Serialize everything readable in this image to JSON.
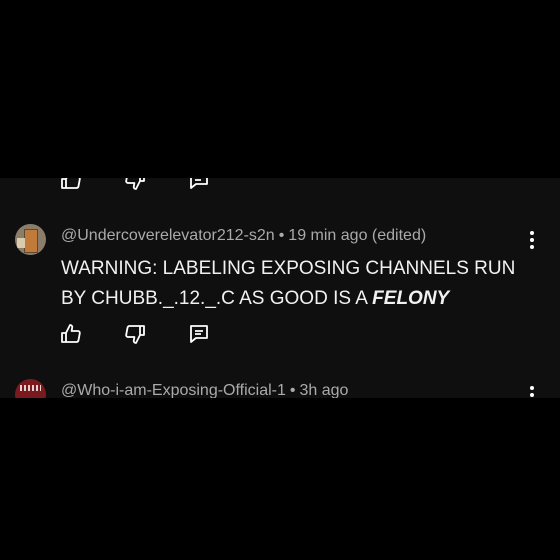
{
  "comments": [
    {
      "author": "@Undercoverelevator212-s2n",
      "time": "19 min ago",
      "edited": "(edited)",
      "text": "WARNING: LABELING EXPOSING CHANNELS RUN BY CHUBB._.12._.C AS GOOD IS A ",
      "text_emphasis": "FELONY"
    },
    {
      "author": "@Who-i-am-Exposing-Official-1",
      "time": "3h ago"
    }
  ],
  "separator": "•",
  "icons": {
    "like": "thumbs-up-icon",
    "dislike": "thumbs-down-icon",
    "reply": "reply-comment-icon",
    "more": "more-vert-icon"
  },
  "colors": {
    "background": "#0f0f0f",
    "text": "#f1f1f1",
    "meta": "#aaaaaa"
  }
}
